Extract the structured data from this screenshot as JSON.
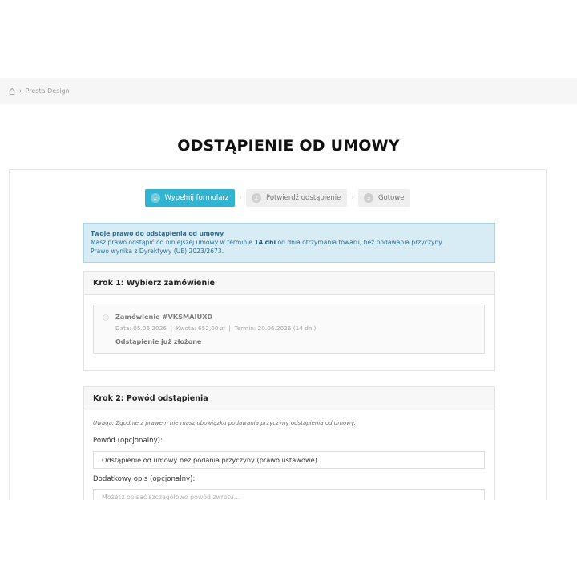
{
  "breadcrumb": {
    "home_icon": "home-icon",
    "separator": "›",
    "current": "Presta Design"
  },
  "page": {
    "title": "ODSTĄPIENIE OD UMOWY"
  },
  "steps": [
    {
      "number": "1",
      "label": "Wypełnij formularz",
      "active": true
    },
    {
      "number": "2",
      "label": "Potwierdź odstąpienie",
      "active": false
    },
    {
      "number": "3",
      "label": "Gotowe",
      "active": false
    }
  ],
  "step_separator": "›",
  "info": {
    "title": "Twoje prawo do odstąpienia od umowy",
    "line1_before": "Masz prawo odstąpić od niniejszej umowy w terminie ",
    "line1_bold": "14 dni",
    "line1_after": " od dnia otrzymania towaru, bez podawania przyczyny.",
    "line2": "Prawo wynika z Dyrektywy (UE) 2023/2673."
  },
  "step1": {
    "heading": "Krok 1: Wybierz zamówienie",
    "order": {
      "name": "Zamówienie #VKSMAIUXD",
      "meta": "Data: 05.06.2026  |  Kwota: 652,00 zł  |  Termin: 20.06.2026 (14 dni)",
      "status": "Odstąpienie już złożone"
    }
  },
  "step2": {
    "heading": "Krok 2: Powód odstąpienia",
    "note": "Uwaga: Zgodnie z prawem nie masz obowiązku podawania przyczyny odstąpienia od umowy.",
    "reason_label": "Powód (opcjonalny):",
    "reason_value": "Odstąpienie od umowy bez podania przyczyny (prawo ustawowe)",
    "description_label": "Dodatkowy opis (opcjonalny):",
    "description_placeholder": "Możesz opisać szczegółowo powód zwrotu..."
  },
  "colors": {
    "accent": "#2fb5d2",
    "info_bg": "#d8ecf6",
    "info_text": "#2c6e8f"
  }
}
